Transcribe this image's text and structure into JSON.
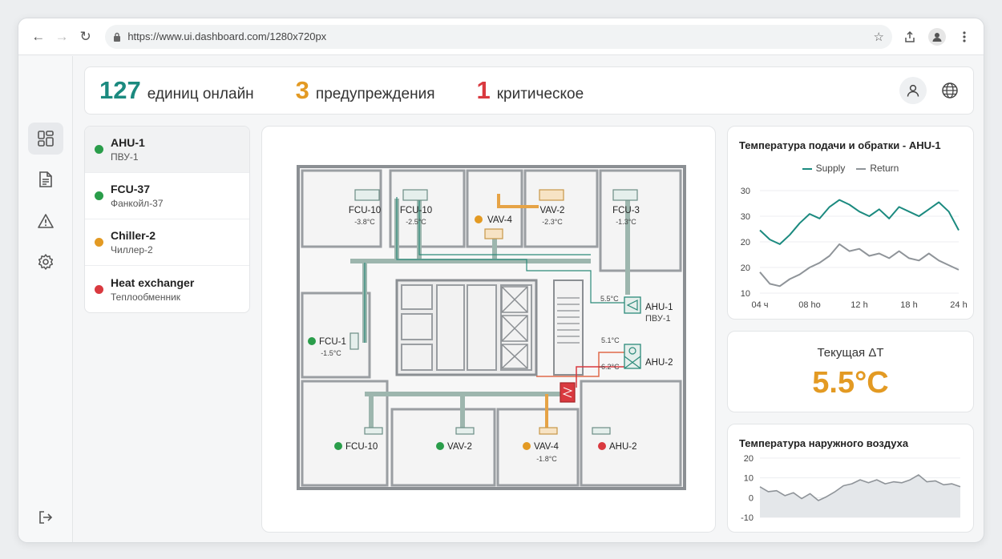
{
  "browser": {
    "url": "https://www.ui.dashboard.com/1280x720px"
  },
  "header": {
    "stats": [
      {
        "value": "127",
        "label": "единиц онлайн",
        "color": "#1b8a7f"
      },
      {
        "value": "3",
        "label": "предупреждения",
        "color": "#e39a23"
      },
      {
        "value": "1",
        "label": "критическое",
        "color": "#d9393f"
      }
    ]
  },
  "status_colors": {
    "ok": "#2a9d4a",
    "warning": "#e39a23",
    "critical": "#d9393f"
  },
  "devices": [
    {
      "name": "AHU-1",
      "sub": "ПВУ-1",
      "status": "ok"
    },
    {
      "name": "FCU-37",
      "sub": "Фанкойл-37",
      "status": "ok"
    },
    {
      "name": "Chiller-2",
      "sub": "Чиллер-2",
      "status": "warning"
    },
    {
      "name": "Heat exchanger",
      "sub": "Теплообменник",
      "status": "critical"
    }
  ],
  "floorplan": {
    "units": [
      {
        "name": "FCU-10",
        "temp": "-3.8°C"
      },
      {
        "name": "FCU-10",
        "temp": "-2.5°C"
      },
      {
        "name": "VAV-4"
      },
      {
        "name": "VAV-2",
        "temp": "-2.3°C"
      },
      {
        "name": "FCU-3",
        "temp": "-1.3°C"
      },
      {
        "name": "FCU-1",
        "temp": "-1.5°C"
      },
      {
        "name": "AHU-1",
        "sub": "ПВУ-1"
      },
      {
        "name": "AHU-2"
      },
      {
        "name": "FCU-10"
      },
      {
        "name": "VAV-2"
      },
      {
        "name": "VAV-4",
        "temp": "-1.8°C"
      },
      {
        "name": "AHU-2"
      }
    ],
    "duct_labels": [
      "5.5°C",
      "5.1°C",
      "-6.2°C"
    ]
  },
  "supply_return_chart": {
    "title": "Температура подачи и обратки - AHU-1",
    "legend": [
      "Supply",
      "Return"
    ]
  },
  "delta_card": {
    "label": "Текущая ΔT",
    "value": "5.5°C"
  },
  "outdoor_chart": {
    "title": "Температура наружного воздуха"
  },
  "chart_data": [
    {
      "type": "line",
      "title": "Температура подачи и обратки - AHU-1",
      "xlabel": "",
      "ylabel": "",
      "x_ticks": [
        "04 ч",
        "08 ho",
        "12 h",
        "18 h",
        "24 h"
      ],
      "y_ticks": [
        "30",
        "30",
        "20",
        "20",
        "10"
      ],
      "x": [
        4,
        5,
        6,
        7,
        8,
        9,
        10,
        11,
        12,
        13,
        14,
        15,
        16,
        17,
        18,
        19,
        20,
        21,
        22,
        23,
        24
      ],
      "series": [
        {
          "name": "Supply",
          "color": "#1b8a7f",
          "values": [
            23.5,
            21.5,
            20.5,
            22.5,
            25,
            27,
            26,
            28.5,
            30,
            29,
            27.5,
            26.5,
            28,
            26,
            28.5,
            27.5,
            26.5,
            28,
            29.5,
            27.5,
            23.5
          ]
        },
        {
          "name": "Return",
          "color": "#8f9499",
          "values": [
            14.5,
            12,
            11.5,
            13,
            14,
            15.5,
            16.5,
            18,
            20.5,
            19,
            19.5,
            18,
            18.5,
            17.5,
            19,
            17.5,
            17,
            18.5,
            17,
            16,
            15
          ]
        }
      ]
    },
    {
      "type": "area",
      "title": "Температура наружного воздуха",
      "xlabel": "",
      "ylabel": "",
      "y_ticks": [
        "20",
        "10",
        "0",
        "-10"
      ],
      "ylim": [
        -10,
        20
      ],
      "values": [
        5.5,
        3,
        3.5,
        1,
        2.5,
        -0.5,
        2,
        -1.5,
        0.5,
        3,
        6,
        7,
        9,
        7.5,
        9,
        7,
        8,
        7.5,
        9,
        11.5,
        8,
        8.5,
        6.5,
        7,
        5.5
      ]
    }
  ]
}
